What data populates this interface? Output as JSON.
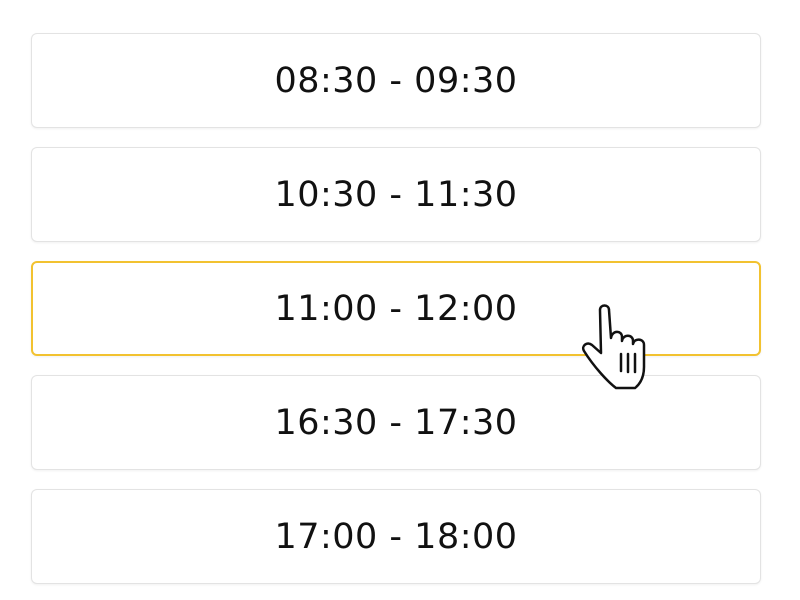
{
  "slots": [
    {
      "label": "08:30 - 09:30",
      "selected": false
    },
    {
      "label": "10:30 - 11:30",
      "selected": false
    },
    {
      "label": "11:00 - 12:00",
      "selected": true
    },
    {
      "label": "16:30 - 17:30",
      "selected": false
    },
    {
      "label": "17:00 - 18:00",
      "selected": false
    }
  ],
  "colors": {
    "selected_border": "#f2c230",
    "default_border": "#e3e3e3",
    "text": "#111111"
  },
  "cursor": {
    "icon": "hand-pointer-icon"
  }
}
